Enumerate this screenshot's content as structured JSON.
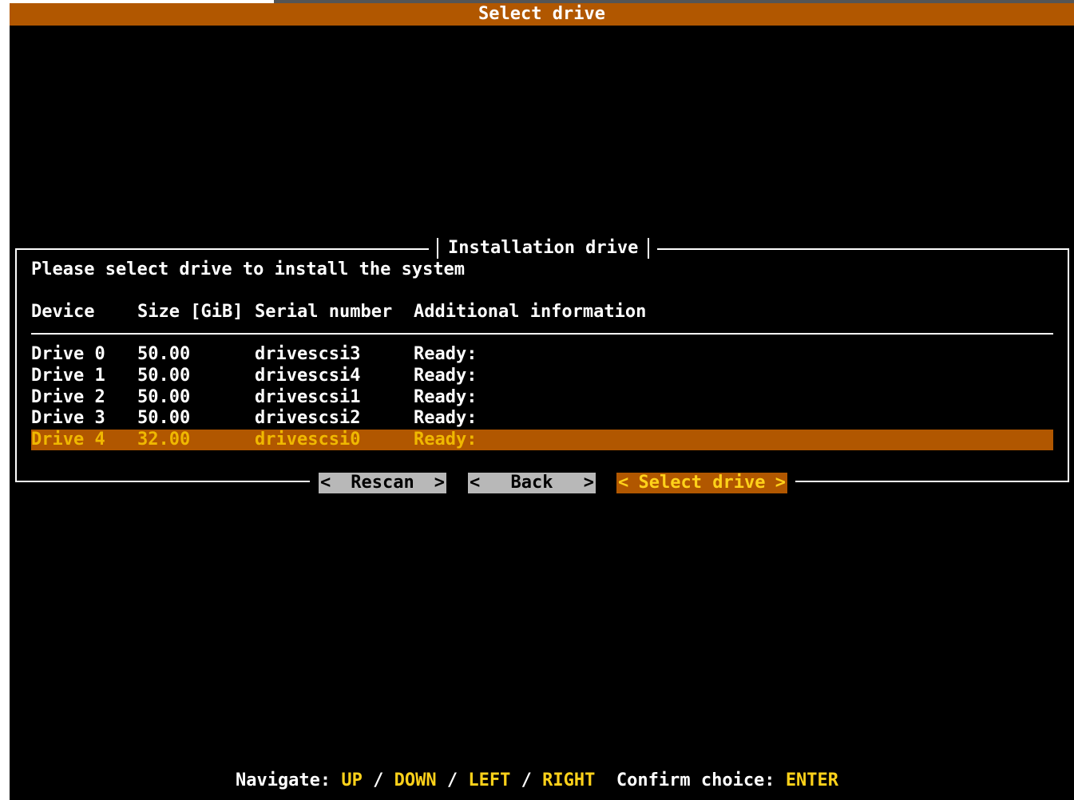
{
  "window": {
    "title": "Select drive"
  },
  "panel": {
    "title": "Installation drive",
    "prompt": "Please select drive to install the system"
  },
  "table": {
    "columns": [
      "Device",
      "Size [GiB]",
      "Serial number",
      "Additional information"
    ],
    "rows": [
      {
        "device": "Drive 0",
        "size": "50.00",
        "serial": "drivescsi3",
        "info": "Ready:",
        "selected": false
      },
      {
        "device": "Drive 1",
        "size": "50.00",
        "serial": "drivescsi4",
        "info": "Ready:",
        "selected": false
      },
      {
        "device": "Drive 2",
        "size": "50.00",
        "serial": "drivescsi1",
        "info": "Ready:",
        "selected": false
      },
      {
        "device": "Drive 3",
        "size": "50.00",
        "serial": "drivescsi2",
        "info": "Ready:",
        "selected": false
      },
      {
        "device": "Drive 4",
        "size": "32.00",
        "serial": "drivescsi0",
        "info": "Ready:",
        "selected": true
      }
    ]
  },
  "buttons": {
    "left_bracket": "<",
    "right_bracket": ">",
    "rescan": "Rescan",
    "back": "Back",
    "select": "Select drive",
    "focused": "select"
  },
  "footer": {
    "navigate_label": "Navigate:",
    "up": "UP",
    "down": "DOWN",
    "left": "LEFT",
    "right": "RIGHT",
    "slash": "/",
    "confirm_label": "Confirm choice:",
    "enter": "ENTER"
  },
  "colors": {
    "accent": "#b15700",
    "highlight_text": "#ffd21a",
    "button_bg": "#b8b8b8",
    "background": "#000000"
  }
}
